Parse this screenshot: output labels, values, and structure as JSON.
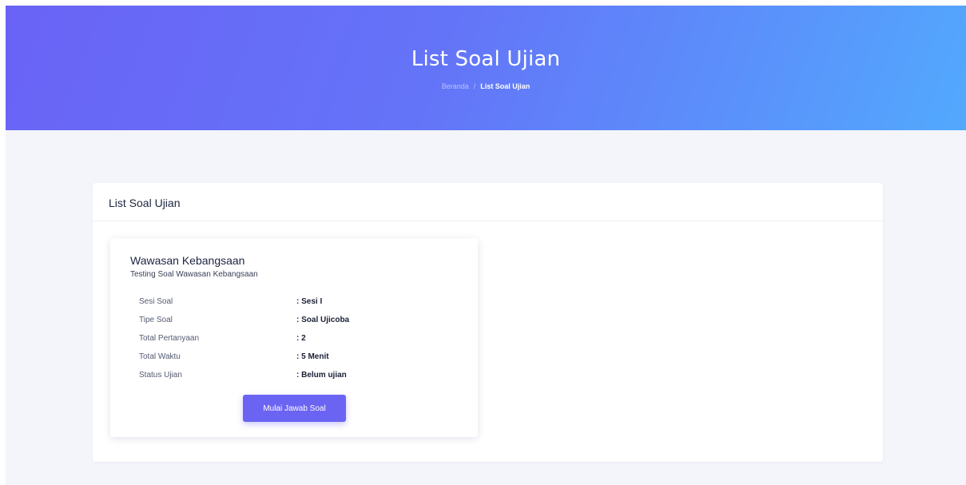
{
  "hero": {
    "title": "List Soal Ujian",
    "breadcrumb": {
      "home": "Beranda",
      "separator": "/",
      "current": "List Soal Ujian"
    }
  },
  "panel": {
    "title": "List Soal Ujian"
  },
  "exam_card": {
    "title": "Wawasan Kebangsaan",
    "subtitle": "Testing Soal Wawasan Kebangsaan",
    "details": [
      {
        "label": "Sesi Soal",
        "value": ": Sesi I"
      },
      {
        "label": "Tipe Soal",
        "value": ": Soal Ujicoba"
      },
      {
        "label": "Total Pertanyaan",
        "value": ": 2"
      },
      {
        "label": "Total Waktu",
        "value": ": 5 Menit"
      },
      {
        "label": "Status Ujian",
        "value": ": Belum ujian"
      }
    ],
    "start_button_label": "Mulai Jawab Soal"
  },
  "colors": {
    "hero_gradient_start": "#6a63f6",
    "hero_gradient_end": "#52a9fd",
    "accent": "#6b64f3",
    "page_background": "#f4f5fb"
  }
}
